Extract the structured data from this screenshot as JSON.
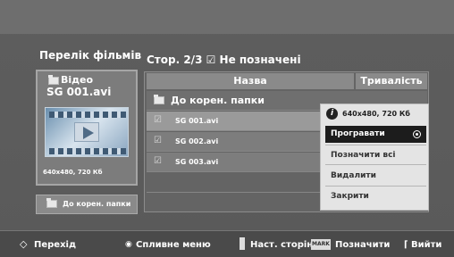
{
  "left_panel": {
    "title": "Перелік фільмів",
    "card_line1": "Відео",
    "card_line2": "SG 001.avi",
    "card_info": "640x480, 720 Кб",
    "root_button": "До корен. папки"
  },
  "list": {
    "page_status": "Стор. 2/3 ☑ Не позначені",
    "col_name": "Назва",
    "col_duration": "Тривалість",
    "root_row": "До корен. папки",
    "files": [
      "SG 001.avi",
      "SG 002.avi",
      "SG 003.avi"
    ],
    "check_glyph": "☑"
  },
  "popup": {
    "info_icon": "i",
    "info": "640x480, 720 Кб",
    "items": [
      "Програвати",
      "Позначити всі",
      "Видалити",
      "Закрити"
    ],
    "selected_index": 0
  },
  "bottom_bar": {
    "move": "Перехід",
    "popup_menu": "Спливне меню",
    "next_page": "Наст. сторінка",
    "mark_key": "MARK",
    "mark": "Позначити",
    "exit": "Вийти"
  },
  "colors": {
    "background": "#5a5a5a",
    "selected_row": "#9a9a9a",
    "popup_bg": "#e4e4e4",
    "popup_selected": "#1c1c1c"
  }
}
